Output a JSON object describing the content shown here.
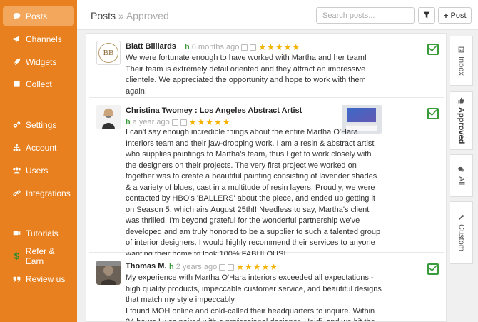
{
  "sidebar": {
    "items": [
      {
        "label": "Posts",
        "icon": "comment-icon"
      },
      {
        "label": "Channels",
        "icon": "bullhorn-icon"
      },
      {
        "label": "Widgets",
        "icon": "rocket-icon"
      },
      {
        "label": "Collect",
        "icon": "square-icon"
      },
      {
        "label": "Settings",
        "icon": "gears-icon"
      },
      {
        "label": "Account",
        "icon": "sitemap-icon"
      },
      {
        "label": "Users",
        "icon": "users-icon"
      },
      {
        "label": "Integrations",
        "icon": "link-icon"
      },
      {
        "label": "Tutorials",
        "icon": "video-icon"
      },
      {
        "label": "Refer & Earn",
        "icon": "dollar-icon"
      },
      {
        "label": "Review us",
        "icon": "quote-icon"
      }
    ]
  },
  "header": {
    "title": "Posts",
    "subtitle": "Approved",
    "search_placeholder": "Search posts...",
    "post_button": "Post"
  },
  "posts": [
    {
      "name": "Blatt Billiards",
      "time": "6 months ago",
      "rating": 5,
      "stars": "★★★★★",
      "text": "We were fortunate enough to have worked with Martha and her team! Their team is extremely detail oriented and they attract an impressive clientele. We appreciated the opportunity and hope to work with them again!",
      "avatar_text": "BB"
    },
    {
      "name": "Christina Twomey : Los Angeles Abstract Artist",
      "time": "a year ago",
      "rating": 5,
      "stars": "★★★★★",
      "text": "I can't say enough incredible things about the entire Martha O'Hara Interiors team and their jaw-dropping work. I am a resin & abstract artist who supplies paintings to Martha's team, thus I get to work closely with the designers on their projects. The very first project we worked on together was to create a beautiful painting consisting of lavender shades & a variety of blues, cast in a multitude of resin layers. Proudly, we were contacted by HBO's 'BALLERS' about the piece, and ended up getting it on Season 5, which airs August 25th!! Needless to say, Martha's client was thrilled! I'm beyond grateful for the wonderful partnership we've developed and am truly honored to be a supplier to such a talented group of interior designers. I would highly recommend their services to anyone wanting their home to look 100% FABULOUS!"
    },
    {
      "name": "Thomas M.",
      "time": "2 years ago",
      "rating": 5,
      "stars": "★★★★★",
      "text": "My experience with Martha O'Hara interiors exceeded all expectations - high quality products, impeccable customer service, and beautiful designs that match my style impeccably.\nI found MOH online and cold-called their headquarters to inquire. Within 24 hours I was paired with a professional designer, Heidi, and we hit the"
    }
  ],
  "tabs": [
    {
      "label": "Inbox",
      "icon": "inbox-icon"
    },
    {
      "label": "Approved",
      "icon": "thumbs-up-icon"
    },
    {
      "label": "All",
      "icon": "comments-icon"
    },
    {
      "label": "Custom",
      "icon": "wrench-icon"
    }
  ],
  "colors": {
    "sidebar": "#e8801f",
    "sidebar_active": "#f2a75c",
    "approve_green": "#3a9b3a",
    "star": "#f5b301"
  }
}
